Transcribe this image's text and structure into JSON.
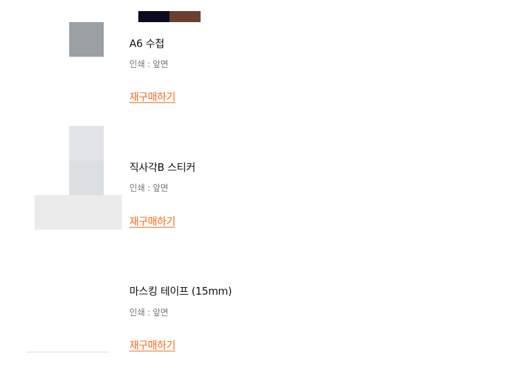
{
  "top_swatch": {
    "colors": [
      "#0b0a1e",
      "#6b3f2f"
    ]
  },
  "orders": [
    {
      "name": "A6 수첩",
      "option": "인쇄 : 앞면",
      "reorder_label": "재구매하기",
      "thumb_color": "#9aa0a3"
    },
    {
      "name": "직사각B 스티커",
      "option": "인쇄 : 앞면",
      "reorder_label": "재구매하기",
      "thumb_colors": [
        "#e2e4e7",
        "#dcdfe2",
        "#ebebeb"
      ]
    },
    {
      "name": "마스킹 테이프 (15mm)",
      "option": "인쇄 : 앞면",
      "reorder_label": "재구매하기",
      "thumb_color": "#ececec"
    }
  ]
}
